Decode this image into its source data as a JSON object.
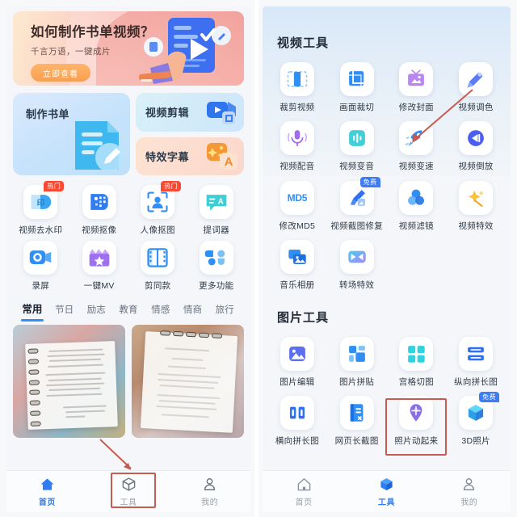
{
  "left_screen": {
    "banner": {
      "title": "如何制作书单视频？",
      "subtitle": "千言万语，一键成片",
      "button_label": "立即查看",
      "art_icon": "hand-tapping-play-video-icon"
    },
    "feature_cards": [
      {
        "label": "制作书单",
        "icon": "document-pencil-icon"
      },
      {
        "label": "视频剪辑",
        "icon": "video-crop-icon"
      },
      {
        "label": "特效字幕",
        "icon": "sparkle-text-icon"
      }
    ],
    "tools": [
      {
        "label": "视频去水印",
        "icon": "watermark-remove-icon",
        "badge": "热门"
      },
      {
        "label": "视频抠像",
        "icon": "video-matting-icon",
        "badge": ""
      },
      {
        "label": "人像抠图",
        "icon": "portrait-cutout-icon",
        "badge": "热门"
      },
      {
        "label": "提词器",
        "icon": "teleprompter-icon",
        "badge": ""
      },
      {
        "label": "录屏",
        "icon": "screen-record-icon",
        "badge": ""
      },
      {
        "label": "一键MV",
        "icon": "mv-clapboard-icon",
        "badge": ""
      },
      {
        "label": "剪同款",
        "icon": "film-strip-icon",
        "badge": ""
      },
      {
        "label": "更多功能",
        "icon": "more-grid-icon",
        "badge": ""
      }
    ],
    "category_tabs": [
      {
        "label": "常用",
        "active": true
      },
      {
        "label": "节日",
        "active": false
      },
      {
        "label": "励志",
        "active": false
      },
      {
        "label": "教育",
        "active": false
      },
      {
        "label": "情感",
        "active": false
      },
      {
        "label": "情商",
        "active": false
      },
      {
        "label": "旅行",
        "active": false
      }
    ],
    "thumbnails": [
      {
        "name": "notebook-handwriting-thumbnail"
      },
      {
        "name": "printed-poem-paper-thumbnail"
      }
    ],
    "bottom_nav": [
      {
        "label": "首页",
        "icon": "home-icon",
        "active": true
      },
      {
        "label": "工具",
        "icon": "cube-tools-icon",
        "active": false
      },
      {
        "label": "我的",
        "icon": "person-icon",
        "active": false
      }
    ]
  },
  "right_screen": {
    "video_section_title": "视频工具",
    "image_section_title": "图片工具",
    "video_tools": [
      {
        "label": "裁剪视频",
        "icon": "trim-video-icon",
        "badge": ""
      },
      {
        "label": "画面裁切",
        "icon": "crop-frame-icon",
        "badge": ""
      },
      {
        "label": "修改封面",
        "icon": "change-cover-icon",
        "badge": ""
      },
      {
        "label": "视频调色",
        "icon": "color-grading-icon",
        "badge": ""
      },
      {
        "label": "视频配音",
        "icon": "microphone-icon",
        "badge": ""
      },
      {
        "label": "视频变音",
        "icon": "voice-change-icon",
        "badge": ""
      },
      {
        "label": "视频变速",
        "icon": "rocket-speed-icon",
        "badge": ""
      },
      {
        "label": "视频倒放",
        "icon": "reverse-play-icon",
        "badge": ""
      },
      {
        "label": "修改MD5",
        "icon": "md5-text-icon",
        "badge": ""
      },
      {
        "label": "视频截图修复",
        "icon": "brush-repair-icon",
        "badge": "免费"
      },
      {
        "label": "视频滤镜",
        "icon": "filter-circles-icon",
        "badge": ""
      },
      {
        "label": "视频特效",
        "icon": "magic-wand-icon",
        "badge": ""
      },
      {
        "label": "音乐相册",
        "icon": "photo-album-icon",
        "badge": ""
      },
      {
        "label": "转场特效",
        "icon": "transition-icon",
        "badge": ""
      }
    ],
    "image_tools": [
      {
        "label": "图片编辑",
        "icon": "image-edit-icon",
        "badge": ""
      },
      {
        "label": "图片拼贴",
        "icon": "collage-icon",
        "badge": ""
      },
      {
        "label": "宫格切图",
        "icon": "grid-split-icon",
        "badge": ""
      },
      {
        "label": "纵向拼长图",
        "icon": "vertical-stitch-icon",
        "badge": ""
      },
      {
        "label": "横向拼长图",
        "icon": "horizontal-stitch-icon",
        "badge": ""
      },
      {
        "label": "网页长截图",
        "icon": "webpage-capture-icon",
        "badge": ""
      },
      {
        "label": "照片动起来",
        "icon": "photo-animate-icon",
        "badge": ""
      },
      {
        "label": "3D照片",
        "icon": "cube-3d-icon",
        "badge": "免费"
      }
    ],
    "bottom_nav": [
      {
        "label": "首页",
        "icon": "home-icon",
        "active": false
      },
      {
        "label": "工具",
        "icon": "cube-tools-icon",
        "active": true
      },
      {
        "label": "我的",
        "icon": "person-icon",
        "active": false
      }
    ]
  },
  "annotations": {
    "accent_color": "#c75b52",
    "left_highlight_target": "工具",
    "right_highlight_target": "照片动起来"
  }
}
